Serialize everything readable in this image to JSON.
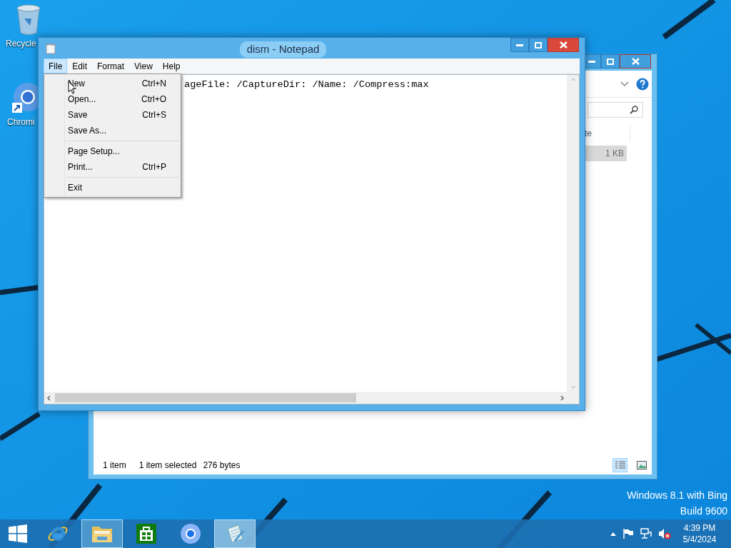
{
  "desktop": {
    "icons": [
      {
        "kind": "recycle",
        "label": "Recycle"
      },
      {
        "kind": "chromium",
        "label": "Chromi"
      }
    ],
    "watermark": [
      "Windows 8.1 with Bing",
      "Build 9600"
    ]
  },
  "explorer": {
    "column_header": "te",
    "size_cell": "1 KB",
    "status": [
      "1 item",
      "1 item selected",
      "276 bytes"
    ],
    "views": [
      {
        "kind": "details",
        "selected": true
      },
      {
        "kind": "large",
        "selected": false
      }
    ]
  },
  "notepad": {
    "title": "dism - Notepad",
    "menus": [
      {
        "label": "File",
        "selected": true
      },
      {
        "label": "Edit",
        "selected": false
      },
      {
        "label": "Format",
        "selected": false
      },
      {
        "label": "View",
        "selected": false
      },
      {
        "label": "Help",
        "selected": false
      }
    ],
    "text": "ageFile: /CaptureDir: /Name: /Compress:max",
    "file_menu": [
      {
        "kind": "item",
        "label": "New",
        "shortcut": "Ctrl+N"
      },
      {
        "kind": "item",
        "label": "Open...",
        "shortcut": "Ctrl+O"
      },
      {
        "kind": "item",
        "label": "Save",
        "shortcut": "Ctrl+S"
      },
      {
        "kind": "item",
        "label": "Save As..."
      },
      {
        "kind": "separator"
      },
      {
        "kind": "item",
        "label": "Page Setup..."
      },
      {
        "kind": "item",
        "label": "Print...",
        "shortcut": "Ctrl+P"
      },
      {
        "kind": "separator"
      },
      {
        "kind": "item",
        "label": "Exit"
      }
    ]
  },
  "taskbar": {
    "apps": [
      {
        "kind": "ie",
        "running": false,
        "selected": false
      },
      {
        "kind": "explorer",
        "running": true,
        "selected": false
      },
      {
        "kind": "store",
        "running": false,
        "selected": false
      },
      {
        "kind": "chromium",
        "running": false,
        "selected": false
      },
      {
        "kind": "notepad",
        "running": true,
        "selected": true
      }
    ],
    "tray": {
      "muted": true,
      "time": "4:39 PM",
      "date": "5/4/2024"
    }
  }
}
